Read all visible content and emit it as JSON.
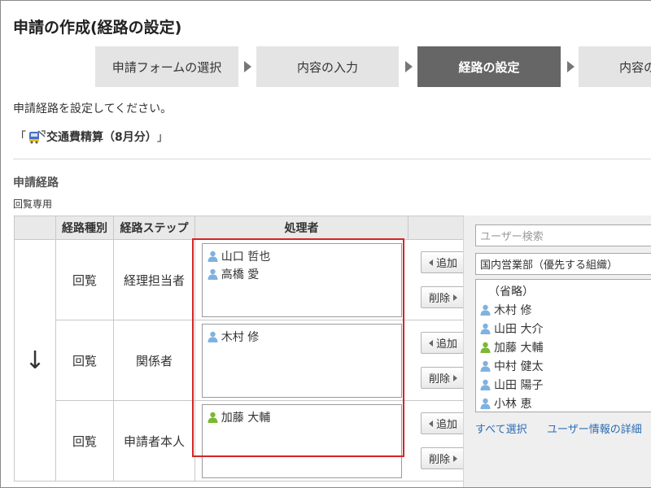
{
  "page_title": "申請の作成(経路の設定)",
  "steps": [
    {
      "label": "申請フォームの選択",
      "active": false
    },
    {
      "label": "内容の入力",
      "active": false
    },
    {
      "label": "経路の設定",
      "active": true
    },
    {
      "label": "内容の",
      "active": false
    }
  ],
  "instruction": "申請経路を設定してください。",
  "form": {
    "open_bracket": "「",
    "name": "交通費精算（8月分）",
    "close_bracket": "」"
  },
  "section_title": "申請経路",
  "route_name": "回覧専用",
  "table": {
    "headers": [
      "経路種別",
      "経路ステップ",
      "処理者"
    ],
    "flow_arrow": "↓",
    "rows": [
      {
        "type": "回覧",
        "step": "経理担当者",
        "processors": [
          {
            "name": "山口 哲也",
            "color": "#7fb2e0"
          },
          {
            "name": "高橋 愛",
            "color": "#7fb2e0"
          }
        ]
      },
      {
        "type": "回覧",
        "step": "関係者",
        "processors": [
          {
            "name": "木村 修",
            "color": "#7fb2e0"
          }
        ]
      },
      {
        "type": "回覧",
        "step": "申請者本人",
        "processors": [
          {
            "name": "加藤 大輔",
            "color": "#7cb832"
          }
        ]
      }
    ],
    "add_label": "追加",
    "delete_label": "削除"
  },
  "panel": {
    "search_placeholder": "ユーザー検索",
    "org_selected": "国内営業部（優先する組織）",
    "omit_label": "（省略）",
    "users": [
      {
        "name": "木村 修",
        "color": "#7fb2e0"
      },
      {
        "name": "山田 大介",
        "color": "#7fb2e0"
      },
      {
        "name": "加藤 大輔",
        "color": "#7cb832"
      },
      {
        "name": "中村 健太",
        "color": "#7fb2e0"
      },
      {
        "name": "山田 陽子",
        "color": "#7fb2e0"
      },
      {
        "name": "小林 恵",
        "color": "#7fb2e0"
      }
    ],
    "select_all": "すべて選択",
    "user_detail": "ユーザー情報の詳細"
  },
  "colors": {
    "highlight": "#d62424",
    "active_step": "#666666",
    "link": "#2b6cb5"
  }
}
